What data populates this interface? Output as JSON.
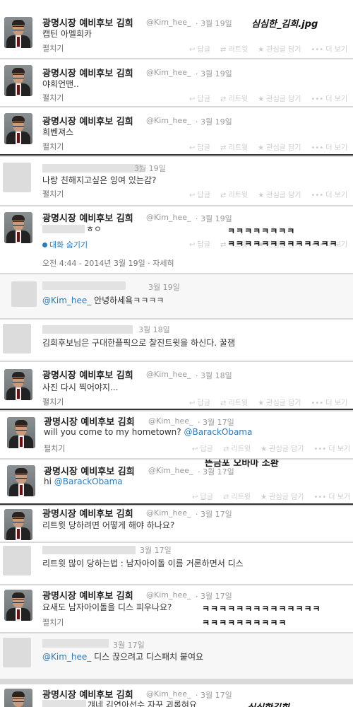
{
  "captions": {
    "top": "심심한_김희.jpg",
    "obama": "뜬금포 오바마 소환",
    "bottom": "심심한김희"
  },
  "laughs": {
    "k1": "ㅋㅋㅋㅋㅋㅋㅋㅋ",
    "k2": "ㅋㅋㅋㅋㅋㅋㅋㅋㅋㅋㅋㅋㅋ",
    "k3": "ㅋㅋㅋㅋㅋㅋㅋㅋㅋㅋㅋㅋㅋㅋ",
    "k4": "ㅋㅋㅋㅋㅋㅋㅋㅋㅋㅋ"
  },
  "common": {
    "name": "광명시장 예비후보 김희",
    "handle": "@Kim_hee_",
    "expand": "펼치기",
    "reply": "↩ 답글",
    "retweet": "⇄ 리트윗",
    "fav": "★ 관심글 담기",
    "more": "••• 더 보기"
  },
  "tweets": [
    {
      "time": "· 3월 19일",
      "text": "캡틴 아멜희카"
    },
    {
      "time": "· 3월 19일",
      "text": "야희언맨.."
    },
    {
      "time": "· 3월 19일",
      "text": "희벤져스"
    },
    {
      "time": "3월 19일",
      "text": "나랑 친해지고싶은 잉여 있는감?"
    },
    {
      "time": "· 3월 19일",
      "text": "ㅎㅇ",
      "convo": "대화 숨기기",
      "meta": "오전 4:44 - 2014년 3월 19일 · 자세히"
    },
    {
      "time": "3월 19일",
      "mention": "@Kim_hee_",
      "text": " 안녕하세욬ㅋㅋㅋㅋ"
    },
    {
      "time": "3월 18일",
      "text": "김희후보님은 구대한플픽으로 찰진트윗을 하신다. 꿀잼"
    },
    {
      "time": "· 3월 18일",
      "text": "사진 다시 찍어야지..."
    },
    {
      "time": "· 3월 17일",
      "text": "will you come to my hometown? ",
      "mention": "@BarackObama"
    },
    {
      "time": "· 3월 17일",
      "text": "hi ",
      "mention": "@BarackObama"
    },
    {
      "time": "· 3월 17일",
      "text": "리트윗 당하려면 어떻게 해야 하나요?"
    },
    {
      "time": "3월 17일",
      "text": "리트윗 많이 당하는법 : 남자아이돌 이름 거론하면서 디스"
    },
    {
      "time": "· 3월 17일",
      "text": "요새도 남자아이돌을 디스 피우나요?"
    },
    {
      "time": "3월 17일",
      "mention": "@Kim_hee_",
      "text": " 디스 끊으려고 디스패치 붙여요"
    },
    {
      "time": "· 3월 17일",
      "text": "걔네 김연아선수 자꾸 괴롭혀요"
    }
  ]
}
